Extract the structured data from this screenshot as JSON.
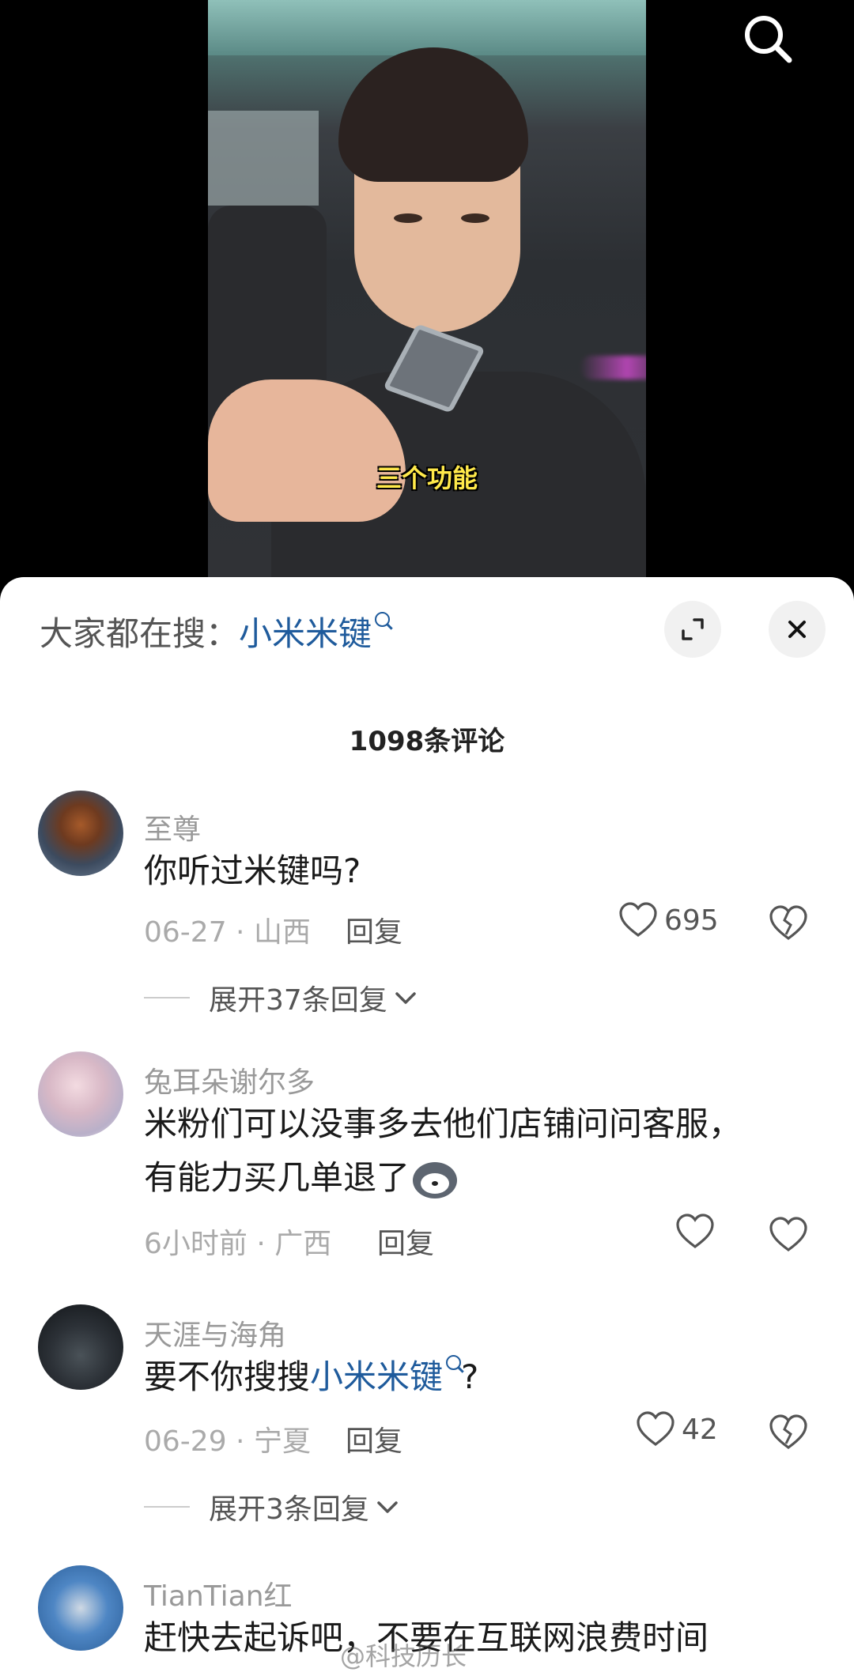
{
  "video": {
    "caption": "三个功能"
  },
  "sheet": {
    "hot_search_prefix": "大家都在搜：",
    "hot_search_keyword": "小米米键",
    "comment_count": "1098条评论"
  },
  "comments": [
    {
      "user": "至尊",
      "text": "你听过米键吗?",
      "date": "06-27",
      "location": "山西",
      "reply_label": "回复",
      "likes": "695",
      "expand_label": "展开37条回复"
    },
    {
      "user": "兔耳朵谢尔多",
      "text_line1": "米粉们可以没事多去他们店铺问问客服，",
      "text_line2": "有能力买几单退了",
      "date": "6小时前",
      "location": "广西",
      "reply_label": "回复"
    },
    {
      "user": "天涯与海角",
      "text_prefix": "要不你搜搜",
      "text_keyword": "小米米键",
      "text_suffix": "?",
      "date": "06-29",
      "location": "宁夏",
      "reply_label": "回复",
      "likes": "42",
      "expand_label": "展开3条回复"
    },
    {
      "user": "TianTian红",
      "text": "赶快去起诉吧，不要在互联网浪费时间"
    }
  ],
  "watermark": "@科技历长",
  "colors": {
    "link_blue": "#1f5b9c",
    "caption_yellow": "#ffe94a"
  }
}
